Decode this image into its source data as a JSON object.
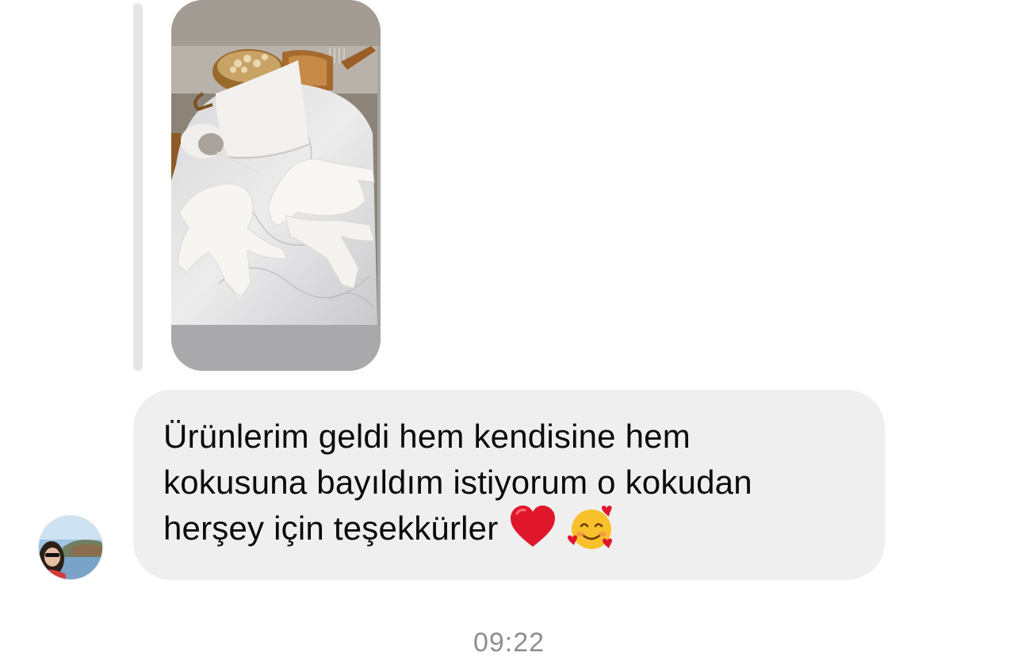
{
  "thread": {
    "shared_story": {
      "icon": "story-photo"
    },
    "message": {
      "lines": [
        "Ürünlerim geldi hem kendisine hem",
        "kokusuna bayıldım istiyorum o kokudan",
        "herşey için teşekkürler"
      ],
      "emojis": [
        "red-heart-icon",
        "smiling-face-with-hearts-icon"
      ]
    },
    "sender": {
      "avatar_icon": "profile-avatar"
    },
    "timestamp": "09:22"
  },
  "colors": {
    "bubble_bg": "#efefef",
    "text": "#0b0b0b",
    "timestamp": "#8e8e8e",
    "quote_bar": "#e6e6e6",
    "heart": "#e0162b",
    "emoji_face": "#f8c12c"
  }
}
